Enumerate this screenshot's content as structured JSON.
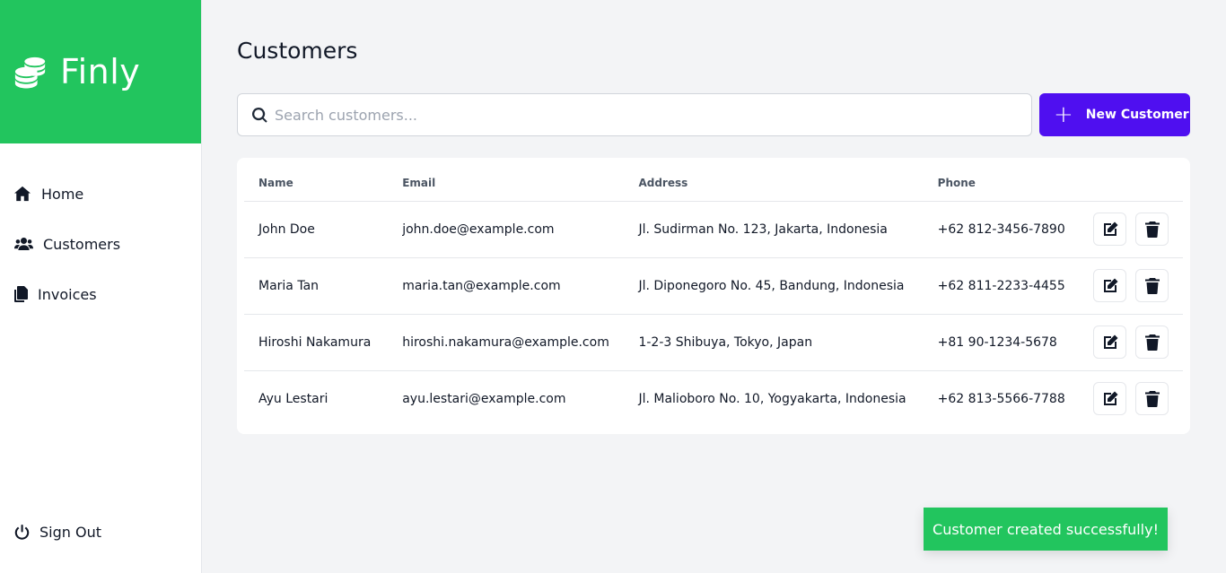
{
  "app": {
    "name": "Finly"
  },
  "sidebar": {
    "items": [
      {
        "label": "Home",
        "icon": "home-icon"
      },
      {
        "label": "Customers",
        "icon": "users-icon"
      },
      {
        "label": "Invoices",
        "icon": "documents-icon"
      }
    ],
    "signout_label": "Sign Out"
  },
  "page": {
    "title": "Customers"
  },
  "search": {
    "placeholder": "Search customers..."
  },
  "new_button": {
    "label": "New Customer"
  },
  "table": {
    "headers": [
      "Name",
      "Email",
      "Address",
      "Phone"
    ],
    "rows": [
      {
        "name": "John Doe",
        "email": "john.doe@example.com",
        "address": "Jl. Sudirman No. 123, Jakarta, Indonesia",
        "phone": "+62 812-3456-7890"
      },
      {
        "name": "Maria Tan",
        "email": "maria.tan@example.com",
        "address": "Jl. Diponegoro No. 45, Bandung, Indonesia",
        "phone": "+62 811-2233-4455"
      },
      {
        "name": "Hiroshi Nakamura",
        "email": "hiroshi.nakamura@example.com",
        "address": "1-2-3 Shibuya, Tokyo, Japan",
        "phone": "+81 90-1234-5678"
      },
      {
        "name": "Ayu Lestari",
        "email": "ayu.lestari@example.com",
        "address": "Jl. Malioboro No. 10, Yogyakarta, Indonesia",
        "phone": "+62 813-5566-7788"
      }
    ]
  },
  "toast": {
    "message": "Customer created successfully!"
  },
  "colors": {
    "brand": "#22c55e",
    "primary_button": "#4f0ff0",
    "background": "#f3f4f6"
  }
}
